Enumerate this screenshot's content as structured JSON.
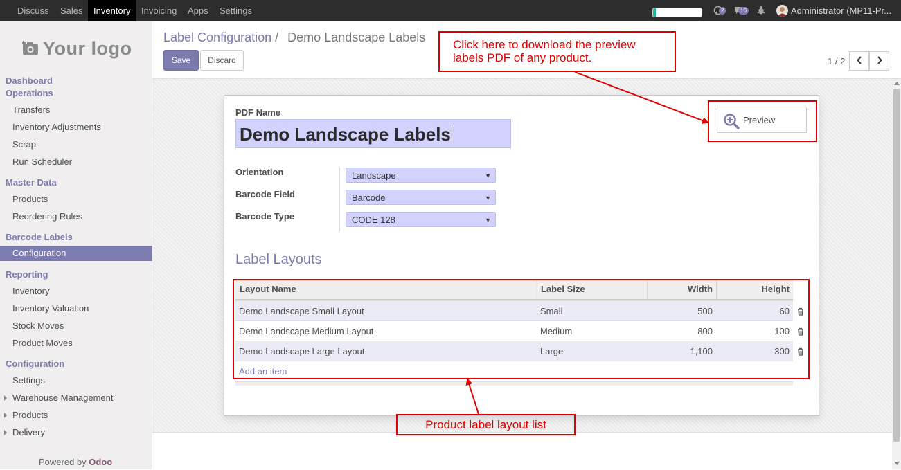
{
  "topbar": {
    "apps": [
      "Discuss",
      "Sales",
      "Inventory",
      "Invoicing",
      "Apps",
      "Settings"
    ],
    "active_app": "Inventory",
    "progress_fraction": 0.05,
    "chat_badge": "2",
    "messages_badge": "10",
    "user": "Administrator (MP11-Pr..."
  },
  "sidebar": {
    "logo_text": "Your logo",
    "sections": [
      {
        "heading": "Dashboard",
        "items": []
      },
      {
        "heading": "Operations",
        "items": [
          "Transfers",
          "Inventory Adjustments",
          "Scrap",
          "Run Scheduler"
        ]
      },
      {
        "heading": "Master Data",
        "items": [
          "Products",
          "Reordering Rules"
        ]
      },
      {
        "heading": "Barcode Labels",
        "items": [
          "Configuration"
        ]
      },
      {
        "heading": "Reporting",
        "items": [
          "Inventory",
          "Inventory Valuation",
          "Stock Moves",
          "Product Moves"
        ]
      },
      {
        "heading": "Configuration",
        "items": [
          "Settings",
          "Warehouse Management",
          "Products",
          "Delivery"
        ]
      }
    ],
    "active_item": "Configuration",
    "powered_by": "Powered by",
    "powered_brand": "Odoo"
  },
  "control": {
    "breadcrumb_parent": "Label Configuration",
    "breadcrumb_sep": "/",
    "breadcrumb_current": "Demo Landscape Labels",
    "save_label": "Save",
    "discard_label": "Discard",
    "pager": "1 / 2"
  },
  "form": {
    "pdf_name_label": "PDF Name",
    "pdf_name_value": "Demo Landscape Labels",
    "preview_label": "Preview",
    "fields": [
      {
        "label": "Orientation",
        "value": "Landscape"
      },
      {
        "label": "Barcode Field",
        "value": "Barcode"
      },
      {
        "label": "Barcode Type",
        "value": "CODE 128"
      }
    ],
    "section_title": "Label Layouts",
    "table": {
      "columns": [
        "Layout Name",
        "Label Size",
        "Width",
        "Height"
      ],
      "rows": [
        {
          "name": "Demo Landscape Small Layout",
          "size": "Small",
          "width": "500",
          "height": "60"
        },
        {
          "name": "Demo Landscape Medium Layout",
          "size": "Medium",
          "width": "800",
          "height": "100"
        },
        {
          "name": "Demo Landscape Large Layout",
          "size": "Large",
          "width": "1,100",
          "height": "300"
        }
      ],
      "add_item": "Add an item"
    }
  },
  "annotations": {
    "preview_note_line1": "Click here to download the preview",
    "preview_note_line2": "labels PDF of any product.",
    "list_note": "Product label layout list",
    "color": "#e00000"
  },
  "colors": {
    "accent": "#7c7bad",
    "topbar": "#2d2d2d",
    "input_bg": "#d2d2ff"
  }
}
